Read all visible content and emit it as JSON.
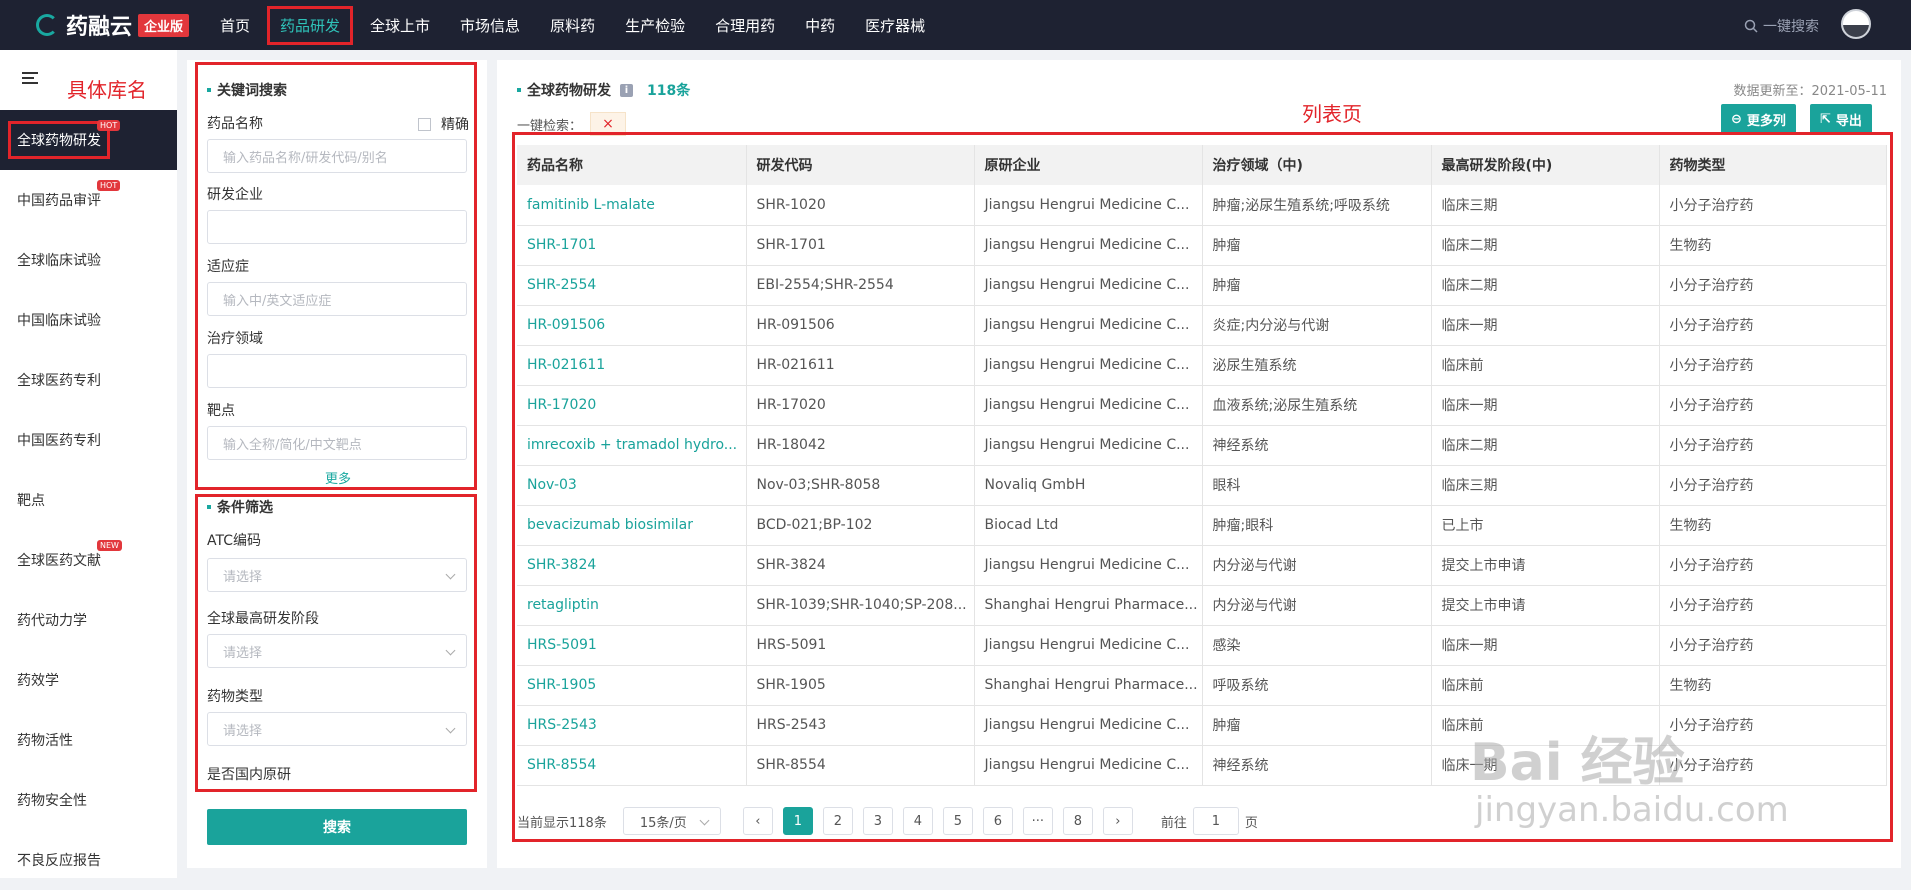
{
  "brand": {
    "name": "药融云",
    "badge": "企业版"
  },
  "nav": {
    "items": [
      "首页",
      "药品研发",
      "全球上市",
      "市场信息",
      "原料药",
      "生产检验",
      "合理用药",
      "中药",
      "医疗器械"
    ],
    "active": "药品研发",
    "search_label": "一键搜索"
  },
  "annotations": {
    "library": "具体库名",
    "list": "列表页"
  },
  "sidebar": {
    "items": [
      {
        "label": "全球药物研发",
        "hot": "HOT"
      },
      {
        "label": "中国药品审评",
        "hot": "HOT"
      },
      {
        "label": "全球临床试验"
      },
      {
        "label": "中国临床试验"
      },
      {
        "label": "全球医药专利"
      },
      {
        "label": "中国医药专利"
      },
      {
        "label": "靶点"
      },
      {
        "label": "全球医药文献",
        "hot": "NEW"
      },
      {
        "label": "药代动力学"
      },
      {
        "label": "药效学"
      },
      {
        "label": "药物活性"
      },
      {
        "label": "药物安全性"
      },
      {
        "label": "不良反应报告"
      }
    ]
  },
  "filters": {
    "keyword_title": "关键词搜索",
    "drug_name_label": "药品名称",
    "exact_label": "精确",
    "drug_name_placeholder": "输入药品名称/研发代码/别名",
    "company_label": "研发企业",
    "indication_label": "适应症",
    "indication_placeholder": "输入中/英文适应症",
    "area_label": "治疗领域",
    "target_label": "靶点",
    "target_placeholder": "输入全称/简化/中文靶点",
    "more": "更多",
    "condition_title": "条件筛选",
    "atc_label": "ATC编码",
    "select_placeholder": "请选择",
    "phase_label": "全球最高研发阶段",
    "type_label": "药物类型",
    "domestic_label": "是否国内原研",
    "search_button": "搜索"
  },
  "main": {
    "title": "全球药物研发",
    "info_icon": "i",
    "count": "118条",
    "updated": "数据更新至：2021-05-11",
    "onekey_label": "一键检索：",
    "tag_close": "×",
    "more_cols": "更多列",
    "export": "导出"
  },
  "table": {
    "columns": [
      "药品名称",
      "研发代码",
      "原研企业",
      "治疗领域（中)",
      "最高研发阶段(中)",
      "药物类型"
    ],
    "rows": [
      [
        "famitinib L-malate",
        "SHR-1020",
        "Jiangsu Hengrui Medicine C...",
        "肿瘤;泌尿生殖系统;呼吸系统",
        "临床三期",
        "小分子治疗药"
      ],
      [
        "SHR-1701",
        "SHR-1701",
        "Jiangsu Hengrui Medicine C...",
        "肿瘤",
        "临床二期",
        "生物药"
      ],
      [
        "SHR-2554",
        "EBI-2554;SHR-2554",
        "Jiangsu Hengrui Medicine C...",
        "肿瘤",
        "临床二期",
        "小分子治疗药"
      ],
      [
        "HR-091506",
        "HR-091506",
        "Jiangsu Hengrui Medicine C...",
        "炎症;内分泌与代谢",
        "临床一期",
        "小分子治疗药"
      ],
      [
        "HR-021611",
        "HR-021611",
        "Jiangsu Hengrui Medicine C...",
        "泌尿生殖系统",
        "临床前",
        "小分子治疗药"
      ],
      [
        "HR-17020",
        "HR-17020",
        "Jiangsu Hengrui Medicine C...",
        "血液系统;泌尿生殖系统",
        "临床一期",
        "小分子治疗药"
      ],
      [
        "imrecoxib + tramadol hydro...",
        "HR-18042",
        "Jiangsu Hengrui Medicine C...",
        "神经系统",
        "临床二期",
        "小分子治疗药"
      ],
      [
        "Nov-03",
        "Nov-03;SHR-8058",
        "Novaliq GmbH",
        "眼科",
        "临床三期",
        "小分子治疗药"
      ],
      [
        "bevacizumab biosimilar",
        "BCD-021;BP-102",
        "Biocad Ltd",
        "肿瘤;眼科",
        "已上市",
        "生物药"
      ],
      [
        "SHR-3824",
        "SHR-3824",
        "Jiangsu Hengrui Medicine C...",
        "内分泌与代谢",
        "提交上市申请",
        "小分子治疗药"
      ],
      [
        "retagliptin",
        "SHR-1039;SHR-1040;SP-208...",
        "Shanghai Hengrui Pharmace...",
        "内分泌与代谢",
        "提交上市申请",
        "小分子治疗药"
      ],
      [
        "HRS-5091",
        "HRS-5091",
        "Jiangsu Hengrui Medicine C...",
        "感染",
        "临床一期",
        "小分子治疗药"
      ],
      [
        "SHR-1905",
        "SHR-1905",
        "Shanghai Hengrui Pharmace...",
        "呼吸系统",
        "临床前",
        "生物药"
      ],
      [
        "HRS-2543",
        "HRS-2543",
        "Jiangsu Hengrui Medicine C...",
        "肿瘤",
        "临床前",
        "小分子治疗药"
      ],
      [
        "SHR-8554",
        "SHR-8554",
        "Jiangsu Hengrui Medicine C...",
        "神经系统",
        "临床一期",
        "小分子治疗药"
      ]
    ]
  },
  "pager": {
    "showing": "当前显示118条",
    "page_size": "15条/页",
    "prev": "‹",
    "pages": [
      "1",
      "2",
      "3",
      "4",
      "5",
      "6",
      "···",
      "8"
    ],
    "current": "1",
    "next": "›",
    "goto_label": "前往",
    "goto_value": "1",
    "page_unit": "页"
  },
  "watermark": {
    "main": "Bai 经验",
    "sub": "jingyan.baidu.com"
  },
  "colors": {
    "accent": "#1aa39b",
    "nav_bg": "#1e2232",
    "annotation": "#e2242a"
  }
}
